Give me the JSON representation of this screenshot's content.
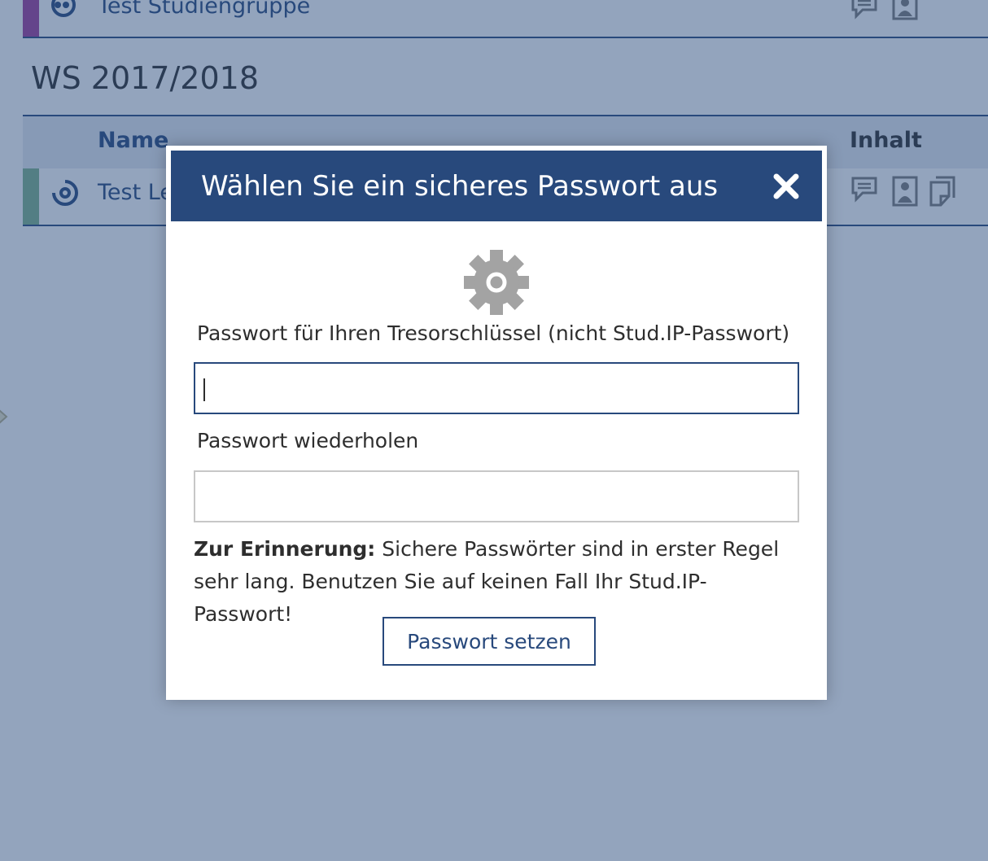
{
  "background": {
    "top_course": {
      "name": "Test Studiengruppe",
      "color": "#a03f9b",
      "icon": "studygroup-icon",
      "content_icons": [
        "forum-icon",
        "participants-icon"
      ]
    },
    "semester_title": "WS 2017/2018",
    "table_header": {
      "name": "Name",
      "content": "Inhalt"
    },
    "course": {
      "name": "Test Le",
      "color": "#7fb38d",
      "icon": "seminar-icon",
      "content_icons": [
        "forum-icon",
        "participants-icon",
        "files-icon"
      ]
    }
  },
  "dialog": {
    "title": "Wählen Sie ein sicheres Passwort aus",
    "close_icon": "close-icon",
    "header_icon": "gear-icon",
    "password_label": "Passwort für Ihren Tresorschlüssel (nicht Stud.IP-Passwort)",
    "password_value": "",
    "repeat_label": "Passwort wiederholen",
    "repeat_value": "",
    "reminder_bold": "Zur Erinnerung:",
    "reminder_text": " Sichere Passwörter sind in erster Regel sehr lang. Benutzen Sie auf keinen Fall Ihr Stud.IP-Passwort!",
    "submit_label": "Passwort setzen"
  },
  "colors": {
    "brand": "#28497c",
    "overlay": "rgba(40, 73, 124, 0.5)",
    "icon_gray": "#a3a3a3"
  }
}
